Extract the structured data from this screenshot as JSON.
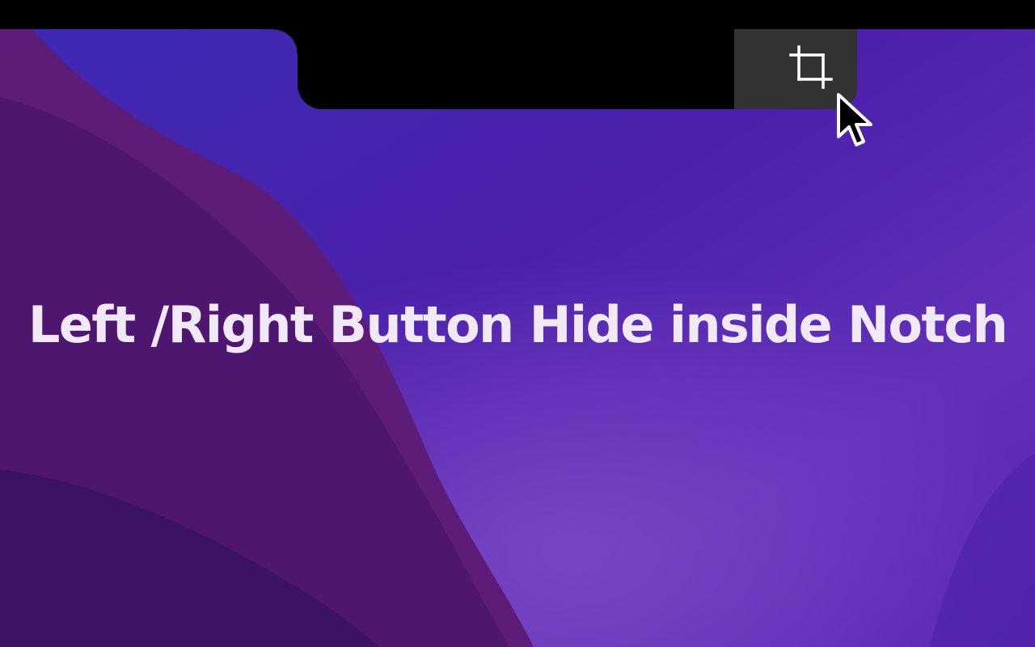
{
  "headline": {
    "text": "Left /Right Button Hide inside Notch"
  },
  "notch_button": {
    "icon": "crop-icon"
  },
  "cursor": {
    "icon": "arrow-cursor-icon"
  },
  "colors": {
    "menubar": "#000000",
    "button_background": "#323232",
    "icon_stroke": "#ffffff",
    "headline_text": "#f1e9f7",
    "wallpaper_purple": "#4a22b0",
    "wallpaper_magenta": "#5c1a6e"
  }
}
